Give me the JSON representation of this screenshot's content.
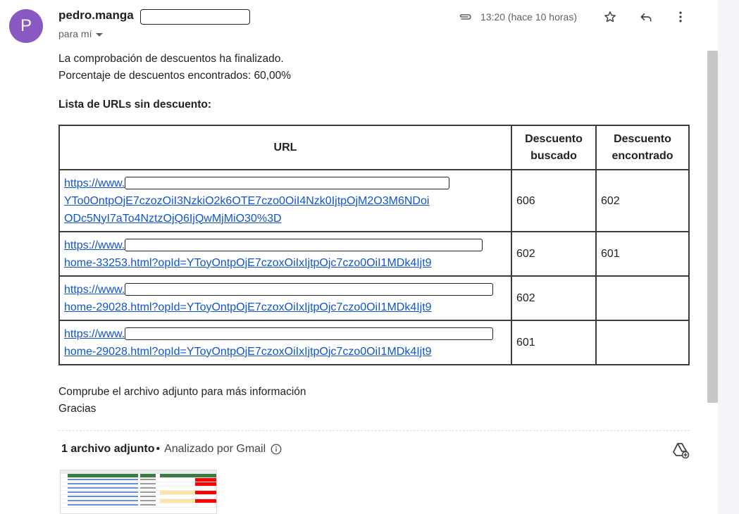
{
  "email": {
    "avatar_letter": "P",
    "sender": "pedro.manga",
    "recipient": "para mí",
    "time": "13:20 (hace 10 horas)",
    "body_line1": "La comprobación de descuentos ha finalizado.",
    "body_line2": "Porcentaje de descuentos encontrados: 60,00%",
    "list_title": "Lista de URLs sin descuento:",
    "footer_line1": "Comprube el archivo adjunto para más información",
    "footer_line2": "Gracias"
  },
  "table": {
    "headers": {
      "url": "URL",
      "buscado": "Descuento buscado",
      "encontrado": "Descuento encontrado"
    },
    "rows": [
      {
        "url_l1": "https://www.",
        "url_l2": "YTo0OntpOjE7czozOiI3NzkiO2k6OTE7czo0OiI4Nzk0IjtpOjM2O3M6NDoi",
        "url_l3": "ODc5NyI7aTo4NztzOjQ6IjQwMjMiO30%3D",
        "buscado": "606",
        "encontrado": "602"
      },
      {
        "url_l1": "https://www.",
        "url_l2": "home-33253.html?opId=YToyOntpOjE7czoxOiIxIjtpOjc7czo0OiI1MDk4Ijt9",
        "buscado": "602",
        "encontrado": "601"
      },
      {
        "url_l1": "https://www.",
        "url_l2": "home-29028.html?opId=YToyOntpOjE7czoxOiIxIjtpOjc7czo0OiI1MDk4Ijt9",
        "buscado": "602",
        "encontrado": ""
      },
      {
        "url_l1": "https://www.",
        "url_l2": "home-29028.html?opId=YToyOntpOjE7czoxOiIxIjtpOjc7czo0OiI1MDk4Ijt9",
        "buscado": "601",
        "encontrado": ""
      }
    ]
  },
  "attachments": {
    "count_label": "1 archivo adjunto",
    "dot": "•",
    "scanned": "Analizado por Gmail"
  },
  "icons": {
    "attachment": "paperclip-icon",
    "star": "star-icon",
    "reply": "reply-icon",
    "more": "more-vert-icon",
    "info": "info-icon",
    "drive": "add-to-drive-icon"
  },
  "colors": {
    "avatar": "#8a58c2",
    "link": "#1155cc"
  }
}
